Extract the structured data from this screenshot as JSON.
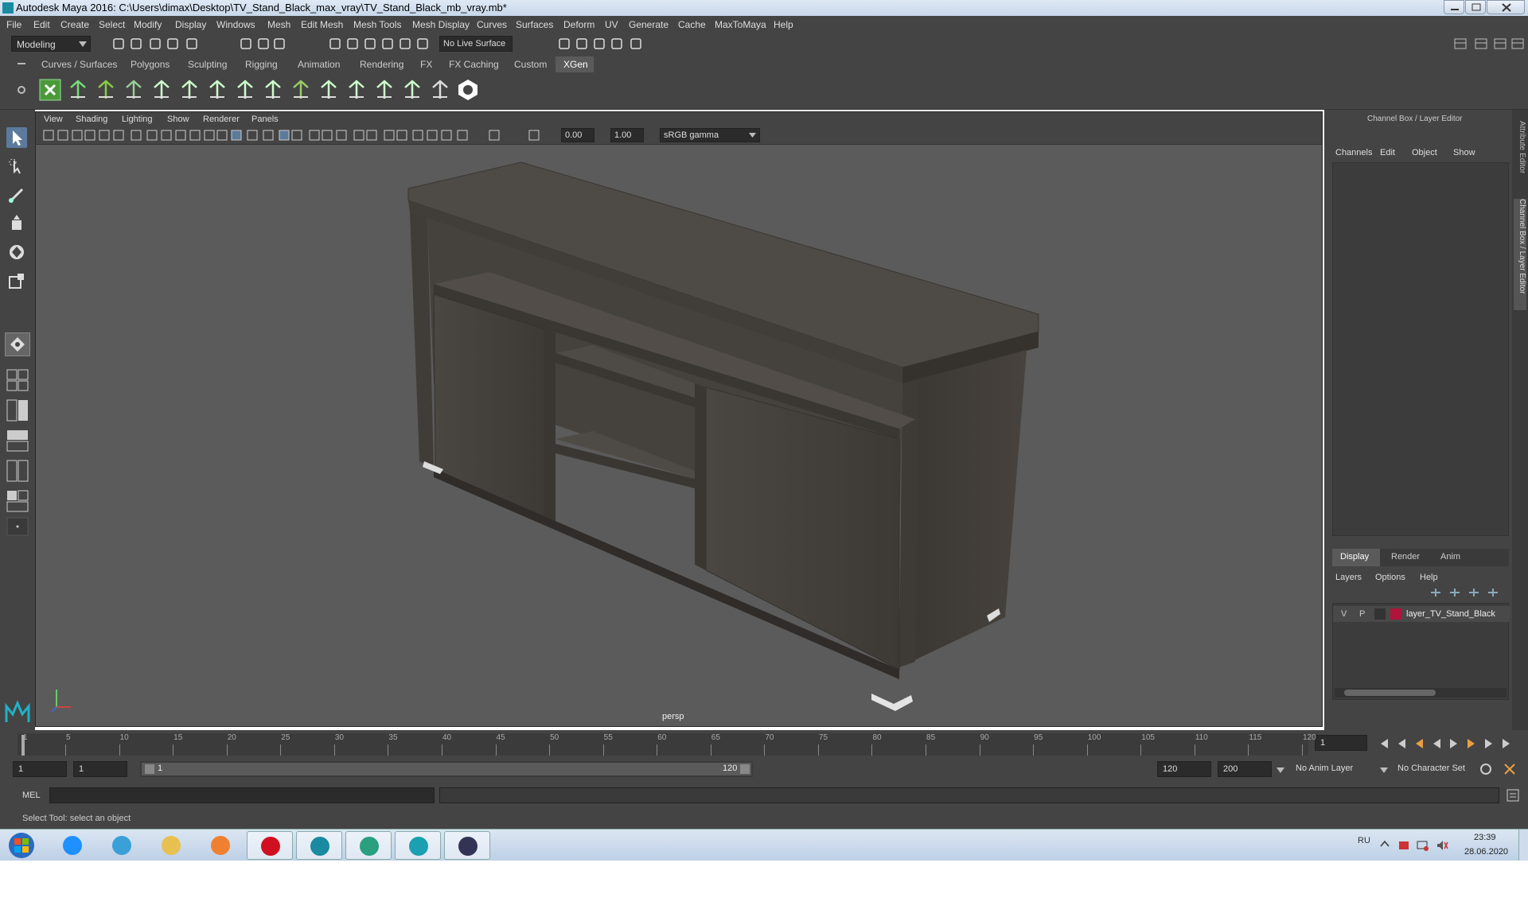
{
  "window": {
    "title": "Autodesk Maya 2016: C:\\Users\\dimax\\Desktop\\TV_Stand_Black_max_vray\\TV_Stand_Black_mb_vray.mb*"
  },
  "menu": [
    "File",
    "Edit",
    "Create",
    "Select",
    "Modify",
    "Display",
    "Windows",
    "Mesh",
    "Edit Mesh",
    "Mesh Tools",
    "Mesh Display",
    "Curves",
    "Surfaces",
    "Deform",
    "UV",
    "Generate",
    "Cache",
    "MaxToMaya",
    "Help"
  ],
  "toolbar": {
    "mode": "Modeling",
    "live_surface": "No Live Surface"
  },
  "shelf_tabs": [
    "Curves / Surfaces",
    "Polygons",
    "Sculpting",
    "Rigging",
    "Animation",
    "Rendering",
    "FX",
    "FX Caching",
    "Custom",
    "XGen"
  ],
  "shelf_active": "XGen",
  "viewport": {
    "menus": [
      "View",
      "Shading",
      "Lighting",
      "Show",
      "Renderer",
      "Panels"
    ],
    "exposure": "0.00",
    "gamma": "1.00",
    "colorspace": "sRGB gamma",
    "camera": "persp"
  },
  "channel_box": {
    "title": "Channel Box / Layer Editor",
    "menus": [
      "Channels",
      "Edit",
      "Object",
      "Show"
    ]
  },
  "layer_editor": {
    "tabs": [
      "Display",
      "Render",
      "Anim"
    ],
    "menus": [
      "Layers",
      "Options",
      "Help"
    ],
    "layer": {
      "v": "V",
      "p": "P",
      "name": "layer_TV_Stand_Black",
      "color": "#b0143a"
    }
  },
  "side_tabs": [
    "Attribute Editor",
    "Channel Box / Layer Editor"
  ],
  "timeline": {
    "ticks": [
      "1",
      "5",
      "10",
      "15",
      "20",
      "25",
      "30",
      "35",
      "40",
      "45",
      "50",
      "55",
      "60",
      "65",
      "70",
      "75",
      "80",
      "85",
      "90",
      "95",
      "100",
      "105",
      "110",
      "115",
      "120"
    ],
    "current": "1"
  },
  "range": {
    "start": "1",
    "playback_start": "1",
    "slider_start": "1",
    "slider_end": "120",
    "end": "120",
    "max": "200",
    "anim_layer": "No Anim Layer",
    "char_set": "No Character Set"
  },
  "mel": {
    "label": "MEL"
  },
  "status": {
    "text": "Select Tool: select an object"
  },
  "taskbar": {
    "lang": "RU",
    "time": "23:39",
    "date": "28.06.2020"
  }
}
